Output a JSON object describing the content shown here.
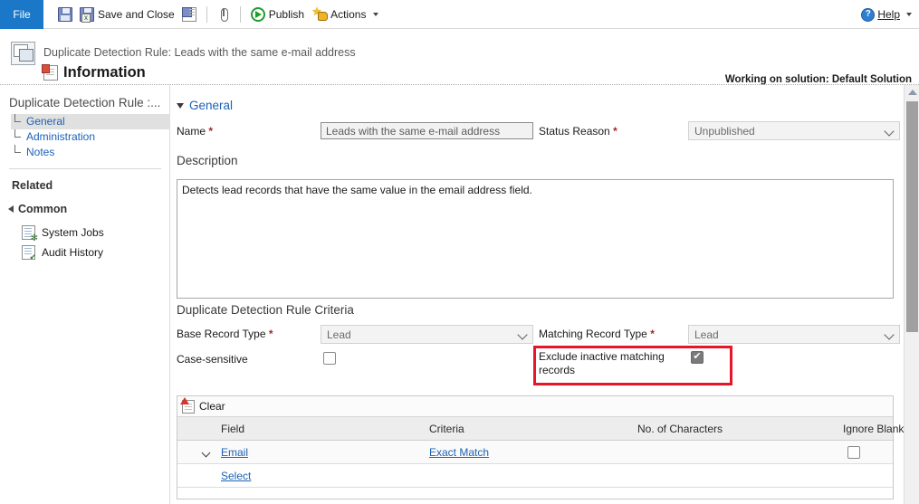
{
  "ribbon": {
    "file_tab": "File",
    "items": [
      {
        "name": "save",
        "icon": "save-icon",
        "label": ""
      },
      {
        "name": "save-and-close",
        "icon": "save-and-close-icon",
        "label": "Save and Close"
      },
      {
        "name": "save-and-new",
        "icon": "save-and-new-icon",
        "label": ""
      },
      {
        "name": "attach",
        "icon": "paperclip-icon",
        "label": ""
      },
      {
        "name": "publish",
        "icon": "publish-icon",
        "label": "Publish"
      },
      {
        "name": "actions",
        "icon": "actions-icon",
        "label": "Actions"
      }
    ],
    "help_label": "Help",
    "help_icon": "help-icon"
  },
  "header": {
    "breadcrumb": "Duplicate Detection Rule: Leads with the same e-mail address",
    "title": "Information",
    "solution_note": "Working on solution: Default Solution"
  },
  "sidebar": {
    "title": "Duplicate Detection Rule :...",
    "items": [
      {
        "label": "General",
        "selected": true
      },
      {
        "label": "Administration",
        "selected": false
      },
      {
        "label": "Notes",
        "selected": false
      }
    ],
    "related_label": "Related",
    "group_label": "Common",
    "sub_items": [
      {
        "label": "System Jobs",
        "icon": "system-jobs-icon"
      },
      {
        "label": "Audit History",
        "icon": "audit-history-icon"
      }
    ]
  },
  "form": {
    "general_section_label": "General",
    "name_label": "Name",
    "name_required": "*",
    "name_value": "Leads with the same e-mail address",
    "status_reason_label": "Status Reason",
    "status_reason_required": "*",
    "status_reason_value": "Unpublished",
    "description_label": "Description",
    "description_value": "Detects lead records that have the same value in the email address field.",
    "criteria_section_label": "Duplicate Detection Rule Criteria",
    "base_record_type_label": "Base Record Type",
    "base_record_type_required": "*",
    "base_record_type_value": "Lead",
    "matching_record_type_label": "Matching Record Type",
    "matching_record_type_required": "*",
    "matching_record_type_value": "Lead",
    "case_sensitive_label": "Case-sensitive",
    "case_sensitive_checked": false,
    "exclude_inactive_label": "Exclude inactive matching records",
    "exclude_inactive_checked": true
  },
  "grid": {
    "clear_label": "Clear",
    "clear_icon": "clear-icon",
    "columns": [
      "Field",
      "Criteria",
      "No. of Characters",
      "Ignore Blank"
    ],
    "rows": [
      {
        "field": "Email",
        "criteria": "Exact Match",
        "characters": "",
        "ignore_blank": false
      },
      {
        "field": "Select",
        "criteria": "",
        "characters": "",
        "ignore_blank": null
      }
    ]
  },
  "colors": {
    "accent_blue": "#1b78c8",
    "link_blue": "#1b62b5",
    "required_red": "#a4262c",
    "highlight_red": "#e8152a"
  }
}
